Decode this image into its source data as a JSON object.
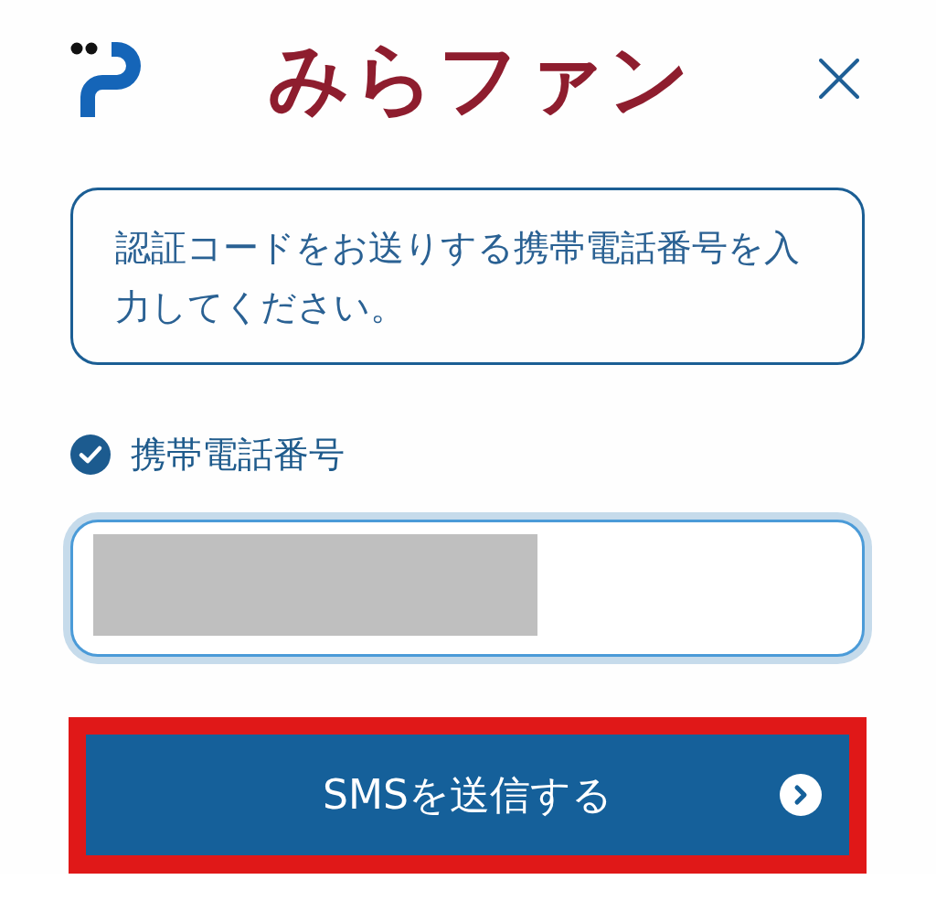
{
  "header": {
    "title": "みらファン"
  },
  "notice": {
    "text": "認証コードをお送りする携帯電話番号を入力してください。"
  },
  "phone_field": {
    "label": "携帯電話番号",
    "checked": true,
    "redacted": true
  },
  "submit_button": {
    "label": "SMSを送信する",
    "highlighted": true
  }
}
